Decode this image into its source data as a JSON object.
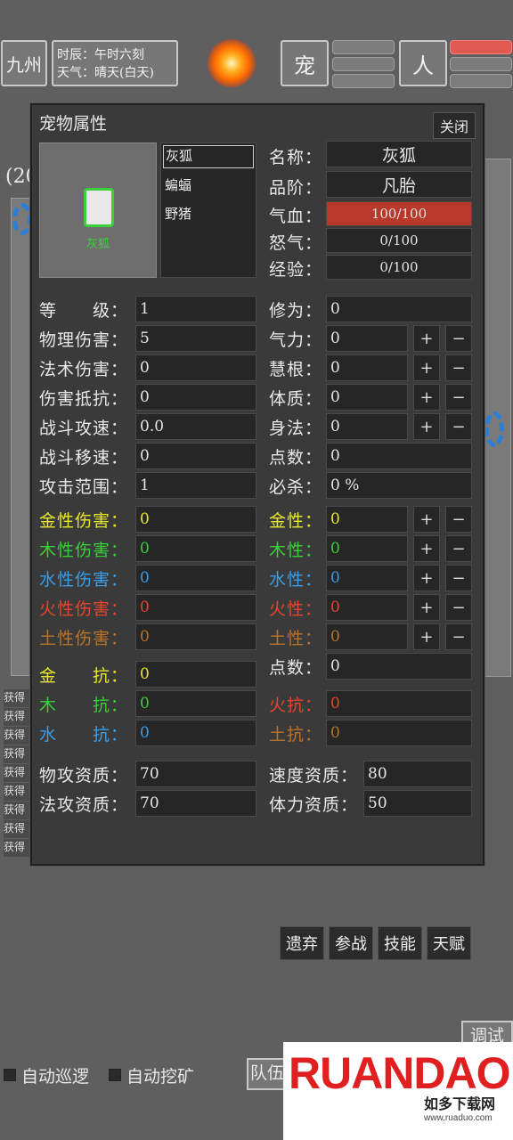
{
  "top": {
    "region": "九州",
    "time_line": "时辰：午时六刻",
    "weather_line": "天气：晴天(白天)",
    "pet_button": "宠",
    "person_button": "人"
  },
  "background": {
    "left_stub": "(20",
    "log_lines": [
      "获得",
      "获得",
      "获得",
      "获得",
      "获得",
      "获得",
      "获得",
      "获得",
      "获得"
    ],
    "auto_patrol": "自动巡逻",
    "auto_mine": "自动挖矿",
    "team_button": "队伍",
    "debug_button": "调试"
  },
  "panel": {
    "title": "宠物属性",
    "close": "关闭",
    "portrait_label": "灰狐",
    "pet_list": [
      "灰狐",
      "蝙蝠",
      "野猪"
    ],
    "selected_index": 0
  },
  "info": {
    "name_label": "名称：",
    "name_value": "灰狐",
    "grade_label": "品阶：",
    "grade_value": "凡胎",
    "hp_label": "气血：",
    "hp_value": "100/100",
    "rage_label": "怒气：",
    "rage_value": "0/100",
    "exp_label": "经验：",
    "exp_value": "0/100"
  },
  "stats_left": [
    {
      "label": "等　　级：",
      "value": "1"
    },
    {
      "label": "物理伤害：",
      "value": "5"
    },
    {
      "label": "法术伤害：",
      "value": "0"
    },
    {
      "label": "伤害抵抗：",
      "value": "0"
    },
    {
      "label": "战斗攻速：",
      "value": "0.0"
    },
    {
      "label": "战斗移速：",
      "value": "0"
    },
    {
      "label": "攻击范围：",
      "value": "1"
    }
  ],
  "stats_right": [
    {
      "label": "修为：",
      "value": "0"
    },
    {
      "label": "气力：",
      "value": "0"
    },
    {
      "label": "慧根：",
      "value": "0"
    },
    {
      "label": "体质：",
      "value": "0"
    },
    {
      "label": "身法：",
      "value": "0"
    },
    {
      "label": "点数：",
      "value": "0"
    },
    {
      "label": "必杀：",
      "value": "0 %"
    }
  ],
  "element_damage": [
    {
      "label": "金性伤害：",
      "value": "0"
    },
    {
      "label": "木性伤害：",
      "value": "0"
    },
    {
      "label": "水性伤害：",
      "value": "0"
    },
    {
      "label": "火性伤害：",
      "value": "0"
    },
    {
      "label": "土性伤害：",
      "value": "0"
    }
  ],
  "element_attr": [
    {
      "label": "金性：",
      "value": "0"
    },
    {
      "label": "木性：",
      "value": "0"
    },
    {
      "label": "水性：",
      "value": "0"
    },
    {
      "label": "火性：",
      "value": "0"
    },
    {
      "label": "土性：",
      "value": "0"
    }
  ],
  "element_points": {
    "label": "点数：",
    "value": "0"
  },
  "resist_left": [
    {
      "label": "金　　抗：",
      "value": "0"
    },
    {
      "label": "木　　抗：",
      "value": "0"
    },
    {
      "label": "水　　抗：",
      "value": "0"
    }
  ],
  "resist_right": [
    {
      "label": "火抗：",
      "value": "0"
    },
    {
      "label": "土抗：",
      "value": "0"
    }
  ],
  "aptitude": {
    "phys_label": "物攻资质：",
    "phys_value": "70",
    "speed_label": "速度资质：",
    "speed_value": "80",
    "magic_label": "法攻资质：",
    "magic_value": "70",
    "stamina_label": "体力资质：",
    "stamina_value": "50"
  },
  "actions": {
    "abandon": "遗弃",
    "fight": "参战",
    "skills": "技能",
    "talent": "天赋"
  },
  "plus": "+",
  "minus": "−",
  "watermark": {
    "brand": "RUANDAO",
    "site_cn": "如多下载网",
    "url": "www.ruaduo.com"
  },
  "colors": {
    "hp_bar": "#b8382a",
    "metal": "#e8e82a",
    "wood": "#39d039",
    "water": "#3a9de8",
    "fire": "#e8452c",
    "earth": "#b8742a"
  }
}
